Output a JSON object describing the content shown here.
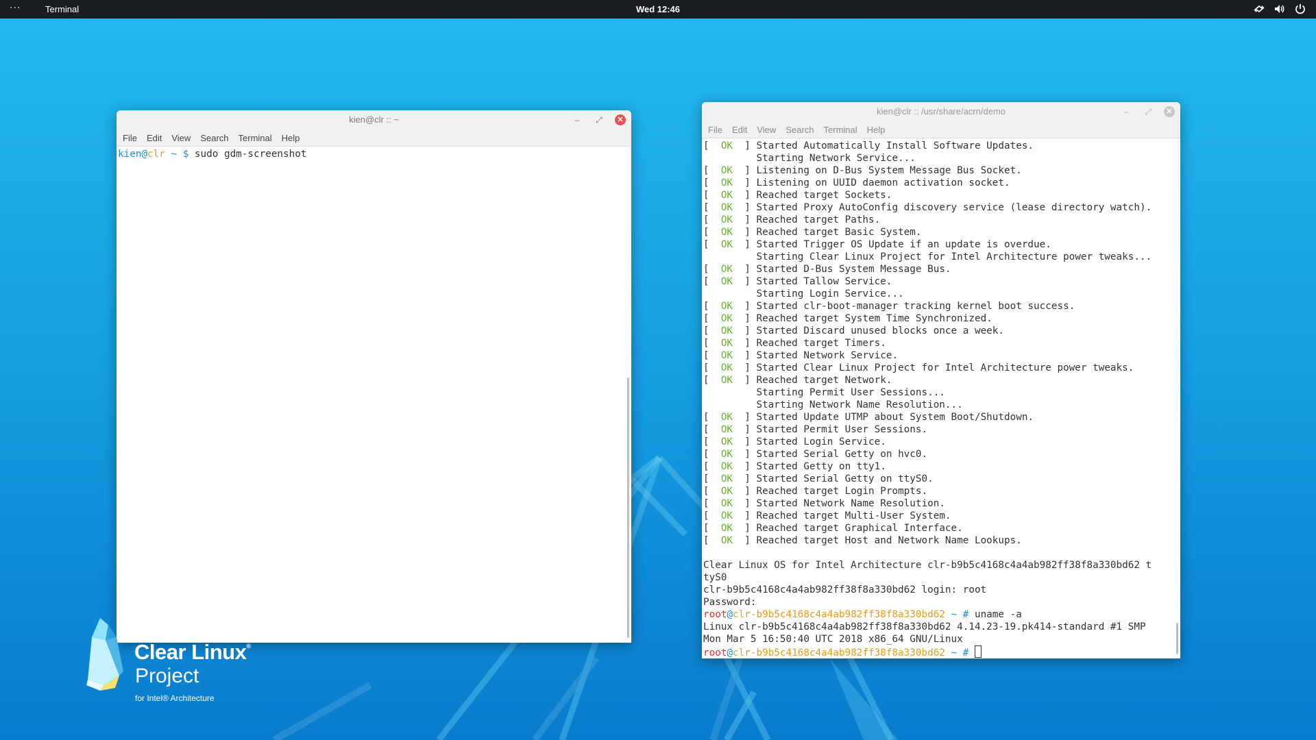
{
  "topbar": {
    "activities": "···",
    "app_name": "Terminal",
    "clock": "Wed 12:46",
    "tray_icons": [
      "network-icon",
      "volume-icon",
      "power-icon"
    ]
  },
  "windows": [
    {
      "title": "kien@clr :: ~",
      "menu": [
        "File",
        "Edit",
        "View",
        "Search",
        "Terminal",
        "Help"
      ],
      "controls": {
        "minimize": "–",
        "maximize": "⤢",
        "close": "✕"
      },
      "prompt": {
        "user": "kien",
        "at": "@",
        "host": "clr",
        "path": " ~ $ ",
        "command": "sudo gdm-screenshot"
      }
    },
    {
      "title": "kien@clr :: /usr/share/acrn/demo",
      "menu": [
        "File",
        "Edit",
        "View",
        "Search",
        "Terminal",
        "Help"
      ],
      "controls": {
        "minimize": "–",
        "maximize": "⤢",
        "close": "✕"
      },
      "boot_lines": [
        {
          "ok": true,
          "text": "Started Automatically Install Software Updates."
        },
        {
          "ok": false,
          "text": "Starting Network Service..."
        },
        {
          "ok": true,
          "text": "Listening on D-Bus System Message Bus Socket."
        },
        {
          "ok": true,
          "text": "Listening on UUID daemon activation socket."
        },
        {
          "ok": true,
          "text": "Reached target Sockets."
        },
        {
          "ok": true,
          "text": "Started Proxy AutoConfig discovery service (lease directory watch)."
        },
        {
          "ok": true,
          "text": "Reached target Paths."
        },
        {
          "ok": true,
          "text": "Reached target Basic System."
        },
        {
          "ok": true,
          "text": "Started Trigger OS Update if an update is overdue."
        },
        {
          "ok": false,
          "text": "Starting Clear Linux Project for Intel Architecture power tweaks..."
        },
        {
          "ok": true,
          "text": "Started D-Bus System Message Bus."
        },
        {
          "ok": true,
          "text": "Started Tallow Service."
        },
        {
          "ok": false,
          "text": "Starting Login Service..."
        },
        {
          "ok": true,
          "text": "Started clr-boot-manager tracking kernel boot success."
        },
        {
          "ok": true,
          "text": "Reached target System Time Synchronized."
        },
        {
          "ok": true,
          "text": "Started Discard unused blocks once a week."
        },
        {
          "ok": true,
          "text": "Reached target Timers."
        },
        {
          "ok": true,
          "text": "Started Network Service."
        },
        {
          "ok": true,
          "text": "Started Clear Linux Project for Intel Architecture power tweaks."
        },
        {
          "ok": true,
          "text": "Reached target Network."
        },
        {
          "ok": false,
          "text": "Starting Permit User Sessions..."
        },
        {
          "ok": false,
          "text": "Starting Network Name Resolution..."
        },
        {
          "ok": true,
          "text": "Started Update UTMP about System Boot/Shutdown."
        },
        {
          "ok": true,
          "text": "Started Permit User Sessions."
        },
        {
          "ok": true,
          "text": "Started Login Service."
        },
        {
          "ok": true,
          "text": "Started Serial Getty on hvc0."
        },
        {
          "ok": true,
          "text": "Started Getty on tty1."
        },
        {
          "ok": true,
          "text": "Started Serial Getty on ttyS0."
        },
        {
          "ok": true,
          "text": "Reached target Login Prompts."
        },
        {
          "ok": true,
          "text": "Started Network Name Resolution."
        },
        {
          "ok": true,
          "text": "Reached target Multi-User System."
        },
        {
          "ok": true,
          "text": "Reached target Graphical Interface."
        },
        {
          "ok": true,
          "text": "Reached target Host and Network Name Lookups."
        }
      ],
      "ok_label": "OK",
      "tail_lines": [
        "",
        "Clear Linux OS for Intel Architecture clr-b9b5c4168c4a4ab982ff38f8a330bd62 t",
        "tyS0",
        "clr-b9b5c4168c4a4ab982ff38f8a330bd62 login: root",
        "Password:"
      ],
      "root_prompt": {
        "user": "root",
        "at": "@",
        "host": "clr-b9b5c4168c4a4ab982ff38f8a330bd62",
        "path": " ~ # "
      },
      "command": "uname -a",
      "output_lines": [
        "Linux clr-b9b5c4168c4a4ab982ff38f8a330bd62 4.14.23-19.pk414-standard #1 SMP",
        "Mon Mar 5 16:50:40 UTC 2018 x86_64 GNU/Linux"
      ]
    }
  ],
  "logo": {
    "title": "Clear Linux",
    "reg": "®",
    "subtitle": "Project",
    "tagline": "for Intel® Architecture"
  }
}
